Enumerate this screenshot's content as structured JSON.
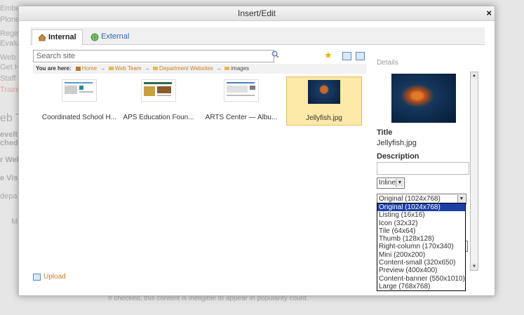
{
  "background": {
    "left_snippets": [
      "Embe",
      "Plone",
      "Regis",
      "Evalua",
      "Web Te",
      "Get He",
      "Staff La",
      "Training",
      "eb Te",
      "evelt",
      "ched",
      "r Web",
      "e Visi",
      "depa",
      "M"
    ],
    "note": "If checked, this content is ineligible to appear in popularity count."
  },
  "dialog": {
    "title": "Insert/Edit",
    "close_label": "×",
    "tabs": [
      {
        "label": "Internal",
        "active": true
      },
      {
        "label": "External",
        "active": false
      }
    ],
    "search_placeholder": "Search site",
    "breadcrumb": {
      "prefix": "You are here:",
      "items": [
        "Home",
        "Web Team",
        "Department Websites",
        "images"
      ]
    },
    "items": [
      {
        "caption": "Coordinated School H...",
        "selected": false
      },
      {
        "caption": "APS Education Foun...",
        "selected": false
      },
      {
        "caption": "ARTS Center — Albu...",
        "selected": false
      },
      {
        "caption": "Jellyfish.jpg",
        "selected": true
      }
    ],
    "upload_label": "Upload",
    "details": {
      "heading": "Details",
      "title_label": "Title",
      "title_value": "Jellyfish.jpg",
      "description_label": "Description",
      "align_value": "Inline",
      "size_value": "Original (1024x768)",
      "size_options": [
        "Original (1024x768)",
        "Listing (16x16)",
        "Icon (32x32)",
        "Tile (64x64)",
        "Thumb (128x128)",
        "Right-column (170x340)",
        "Mini (200x200)",
        "Content-small (320x650)",
        "Preview (400x400)",
        "Content-banner (550x1010)",
        "Large (768x768)"
      ]
    }
  }
}
